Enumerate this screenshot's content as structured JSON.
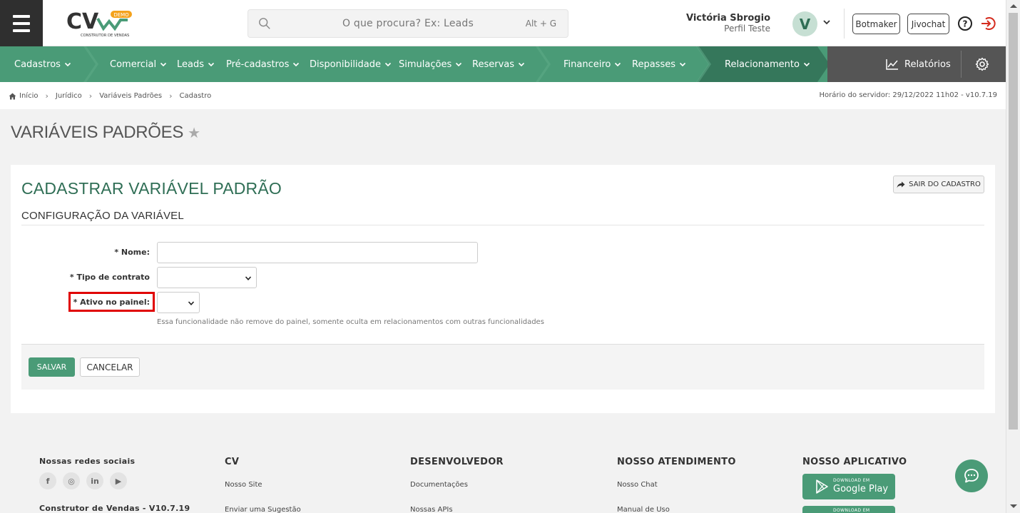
{
  "header": {
    "logo_badge": "DEMO",
    "logo_text": "CV",
    "logo_sub": "CONSTRUTOR DE VENDAS",
    "search_placeholder": "O que procura? Ex: Leads",
    "search_shortcut": "Alt + G",
    "user_name": "Victória Sbrogio",
    "user_profile": "Perfil Teste",
    "avatar_letter": "V",
    "botmaker_label": "Botmaker",
    "jivochat_label": "Jivochat"
  },
  "nav": {
    "items": [
      {
        "label": "Cadastros"
      },
      {
        "label": "Comercial"
      },
      {
        "label": "Leads"
      },
      {
        "label": "Pré-cadastros"
      },
      {
        "label": "Disponibilidade"
      },
      {
        "label": "Simulações"
      },
      {
        "label": "Reservas"
      },
      {
        "label": "Financeiro"
      },
      {
        "label": "Repasses"
      },
      {
        "label": "Relacionamento"
      }
    ],
    "reports_label": "Relatórios",
    "colors": {
      "primary": "#4a9b77",
      "dark": "#3d8565",
      "gray": "#555555"
    }
  },
  "breadcrumb": {
    "items": [
      "Início",
      "Jurídico",
      "Variáveis Padrões",
      "Cadastro"
    ],
    "server_time": "Horário do servidor: 29/12/2022 11h02 - v10.7.19"
  },
  "page": {
    "title": "VARIÁVEIS PADRÕES"
  },
  "form": {
    "title": "CADASTRAR VARIÁVEL PADRÃO",
    "exit_label": "SAIR DO CADASTRO",
    "section": "CONFIGURAÇÃO DA VARIÁVEL",
    "fields": {
      "nome": {
        "label": "* Nome:",
        "value": ""
      },
      "tipo": {
        "label": "* Tipo de contrato",
        "value": ""
      },
      "ativo": {
        "label": "* Ativo no painel:",
        "value": ""
      }
    },
    "hint": "Essa funcionalidade não remove do painel, somente oculta em relacionamentos com outras funcionalidades",
    "save_label": "SALVAR",
    "cancel_label": "CANCELAR"
  },
  "footer": {
    "social_title": "Nossas redes sociais",
    "social_icons": [
      "f",
      "◎",
      "in",
      "▶"
    ],
    "version": "Construtor de Vendas - V10.7.19",
    "cv": {
      "title": "CV",
      "links": [
        "Nosso Site",
        "Enviar uma Sugestão"
      ]
    },
    "dev": {
      "title": "DESENVOLVEDOR",
      "links": [
        "Documentações",
        "Nossas APIs"
      ]
    },
    "support": {
      "title": "NOSSO ATENDIMENTO",
      "links": [
        "Nosso Chat",
        "Manual de Uso"
      ]
    },
    "app": {
      "title": "NOSSO APLICATIVO",
      "google_small": "DOWNLOAD EM",
      "google_big": "Google Play",
      "apple_small": "DOWNLOAD EM"
    }
  }
}
